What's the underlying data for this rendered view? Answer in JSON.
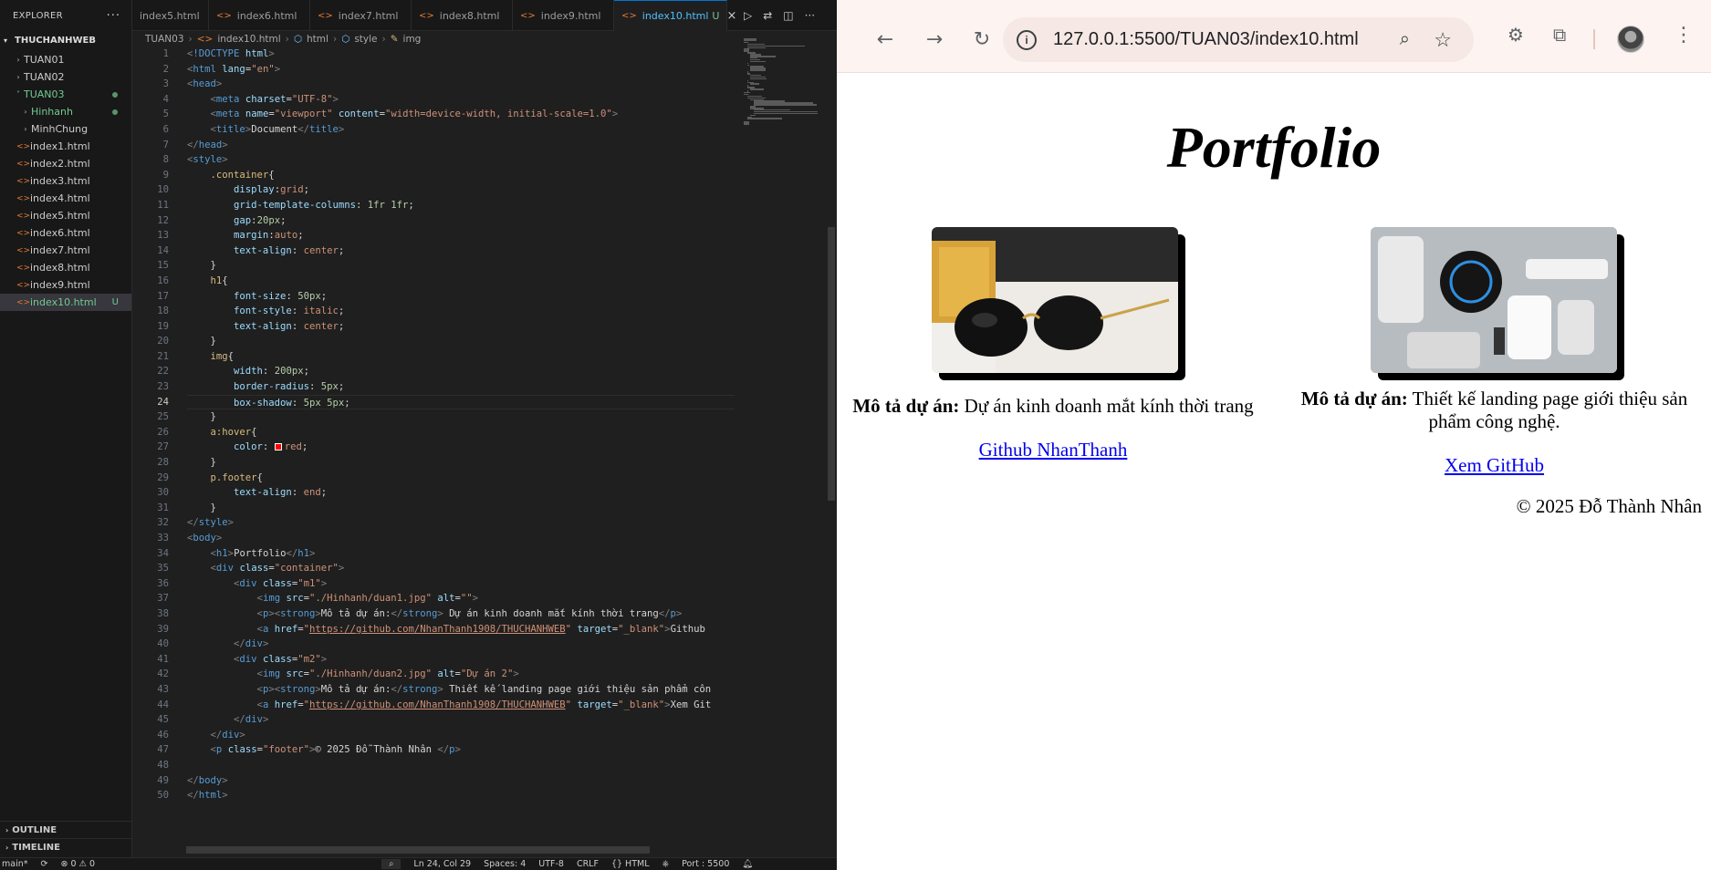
{
  "explorer": {
    "title": "EXPLORER",
    "root": "THUCHANHWEB",
    "items": [
      {
        "label": "TUAN01"
      },
      {
        "label": "TUAN02"
      },
      {
        "label": "TUAN03"
      },
      {
        "label": "Hinhanh"
      },
      {
        "label": "MinhChung"
      },
      {
        "label": "index1.html"
      },
      {
        "label": "index2.html"
      },
      {
        "label": "index3.html"
      },
      {
        "label": "index4.html"
      },
      {
        "label": "index5.html"
      },
      {
        "label": "index6.html"
      },
      {
        "label": "index7.html"
      },
      {
        "label": "index8.html"
      },
      {
        "label": "index9.html"
      },
      {
        "label": "index10.html",
        "badge": "U"
      }
    ],
    "outline": "OUTLINE",
    "timeline": "TIMELINE"
  },
  "tabs": [
    {
      "label": "index5.html"
    },
    {
      "label": "index6.html"
    },
    {
      "label": "index7.html"
    },
    {
      "label": "index8.html"
    },
    {
      "label": "index9.html"
    },
    {
      "label": "index10.html",
      "badge": "U"
    }
  ],
  "breadcrumb": [
    "TUAN03",
    "index10.html",
    "html",
    "style",
    "img"
  ],
  "code_lines": [
    "<!DOCTYPE html>",
    "<html lang=\"en\">",
    "<head>",
    "    <meta charset=\"UTF-8\">",
    "    <meta name=\"viewport\" content=\"width=device-width, initial-scale=1.0\">",
    "    <title>Document</title>",
    "</head>",
    "<style>",
    "    .container{",
    "        display:grid;",
    "        grid-template-columns: 1fr 1fr;",
    "        gap:20px;",
    "        margin:auto;",
    "        text-align: center;",
    "    }",
    "    h1{",
    "        font-size: 50px;",
    "        font-style: italic;",
    "        text-align: center;",
    "    }",
    "    img{",
    "        width: 200px;",
    "        border-radius: 5px;",
    "        box-shadow: 5px 5px;",
    "    }",
    "    a:hover{",
    "        color: red;",
    "    }",
    "    p.footer{",
    "        text-align: end;",
    "    }",
    "</style>",
    "<body>",
    "    <h1>Portfolio</h1>",
    "    <div class=\"container\">",
    "        <div class=\"m1\">",
    "            <img src=\"./Hinhanh/duan1.jpg\" alt=\"\">",
    "            <p><strong>Mô tả dự án:</strong> Dự án kinh doanh mắt kính thời trang</p>",
    "            <a href=\"https://github.com/NhanThanh1908/THUCHANHWEB\" target=\"_blank\">Github",
    "        </div>",
    "        <div class=\"m2\">",
    "            <img src=\"./Hinhanh/duan2.jpg\" alt=\"Dự án 2\">",
    "            <p><strong>Mô tả dự án:</strong> Thiết kế landing page giới thiệu sản phẩm côn",
    "            <a href=\"https://github.com/NhanThanh1908/THUCHANHWEB\" target=\"_blank\">Xem Git",
    "        </div>",
    "    </div>",
    "    <p class=\"footer\">© 2025 Đỗ Thành Nhân </p>",
    "",
    "</body>",
    "</html>"
  ],
  "current_line": 24,
  "statusbar": {
    "branch": "main*",
    "problems": "⊗ 0 ⚠ 0",
    "cursor": "Ln 24, Col 29",
    "spaces": "Spaces: 4",
    "encoding": "UTF-8",
    "eol": "CRLF",
    "language": "{} HTML",
    "port": "Port : 5500"
  },
  "browser": {
    "url": "127.0.0.1:5500/TUAN03/index10.html",
    "page": {
      "title": "Portfolio",
      "projects": [
        {
          "desc_label": "Mô tả dự án:",
          "desc_text": " Dự án kinh doanh mắt kính thời trang",
          "link": "Github NhanThanh"
        },
        {
          "desc_label": "Mô tả dự án:",
          "desc_text": " Thiết kế landing page giới thiệu sản phẩm công nghệ.",
          "link": "Xem GitHub"
        }
      ],
      "footer": "© 2025 Đỗ Thành Nhân"
    }
  },
  "colors": {
    "editor_bg": "#1f1f1f",
    "sidebar_bg": "#181818",
    "accent": "#0078d4",
    "git_untracked": "#73c991",
    "browser_toolbar": "#fdf3f0",
    "link": "#0000ee"
  }
}
